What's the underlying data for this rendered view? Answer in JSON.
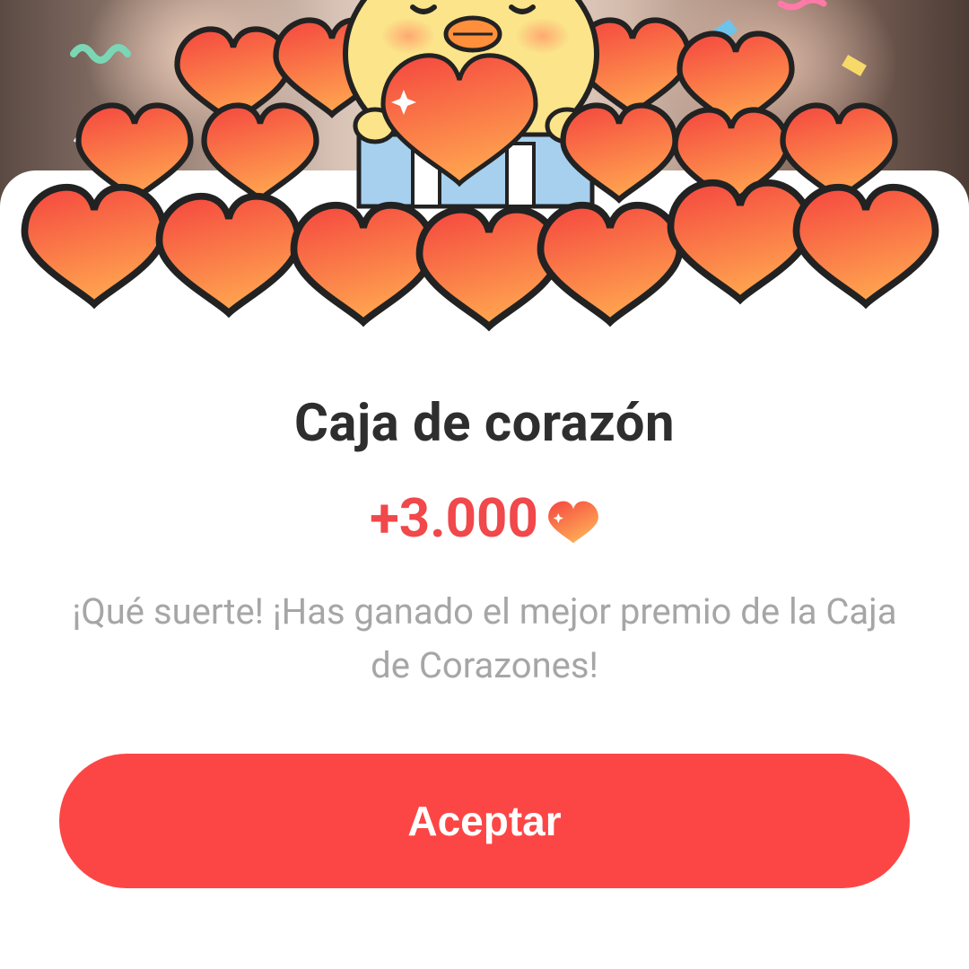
{
  "dialog": {
    "title": "Caja de corazón",
    "reward_amount": "+3.000",
    "reward_icon": "heart-icon",
    "message": "¡Qué suerte! ¡Has ganado el mejor premio de la Caja de Corazones!",
    "accept_label": "Aceptar"
  },
  "colors": {
    "accent": "#fc4645",
    "reward_text": "#f0484b",
    "title_text": "#2e2e2e",
    "message_text": "#a6a6a6"
  }
}
